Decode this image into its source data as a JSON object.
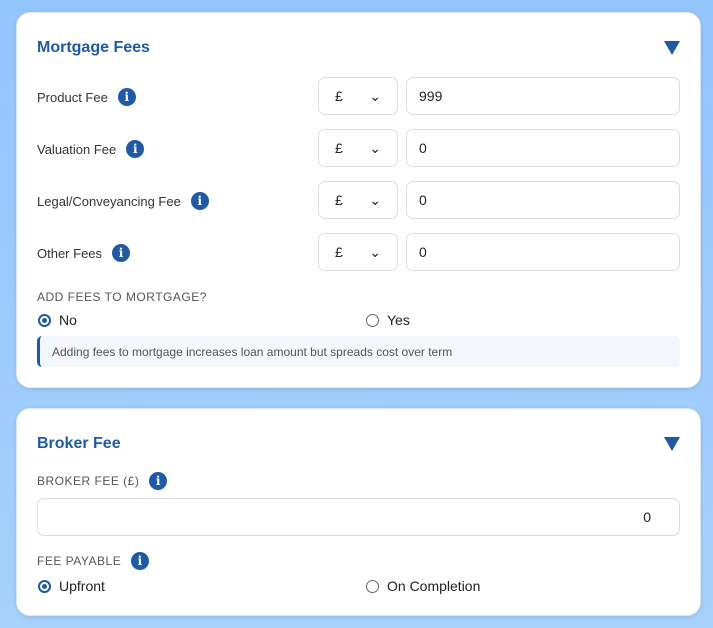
{
  "mortgage_fees": {
    "title": "Mortgage Fees",
    "rows": [
      {
        "label": "Product Fee",
        "unit": "£",
        "value": "999"
      },
      {
        "label": "Valuation Fee",
        "unit": "£",
        "value": "0"
      },
      {
        "label": "Legal/Conveyancing Fee",
        "unit": "£",
        "value": "0"
      },
      {
        "label": "Other Fees",
        "unit": "£",
        "value": "0"
      }
    ],
    "add_fees_label": "ADD FEES TO MORTGAGE?",
    "options": [
      "No",
      "Yes"
    ],
    "selected": "No",
    "note": "Adding fees to mortgage increases loan amount but spreads cost over term"
  },
  "broker_fee": {
    "title": "Broker Fee",
    "amount_label": "BROKER FEE (£)",
    "amount_value": "0",
    "payable_label": "FEE PAYABLE",
    "options": [
      "Upfront",
      "On Completion"
    ],
    "selected": "Upfront"
  },
  "info_glyph": "i"
}
